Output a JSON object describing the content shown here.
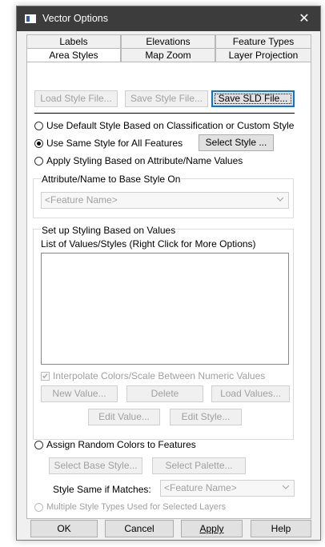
{
  "window": {
    "title": "Vector Options",
    "close_glyph": "✕"
  },
  "tabs": {
    "row1": [
      {
        "label": "Labels"
      },
      {
        "label": "Elevations"
      },
      {
        "label": "Feature Types"
      }
    ],
    "row2": [
      {
        "label": "Area Styles",
        "selected": true
      },
      {
        "label": "Map Zoom"
      },
      {
        "label": "Layer Projection"
      }
    ]
  },
  "style_file_buttons": {
    "load": "Load Style File...",
    "save": "Save Style File...",
    "save_sld": "Save SLD File..."
  },
  "style_mode": {
    "default": "Use Default Style Based on Classification or Custom Style",
    "same": "Use Same Style for All Features",
    "select_style": "Select Style ...",
    "attribute": "Apply Styling Based on Attribute/Name Values",
    "random": "Assign Random Colors to Features",
    "multiple": "Multiple Style Types Used for Selected Layers",
    "selected": "same"
  },
  "attribute_group": {
    "label": "Attribute/Name to Base Style On",
    "value": "<Feature Name>"
  },
  "values_group": {
    "label": "Set up Styling Based on Values",
    "list_label": "List of Values/Styles (Right Click for More Options)",
    "interpolate": "Interpolate Colors/Scale Between Numeric Values",
    "interpolate_checked": true,
    "new_value": "New Value...",
    "delete": "Delete",
    "load_values": "Load Values...",
    "edit_value": "Edit Value...",
    "edit_style": "Edit Style..."
  },
  "random_group": {
    "select_base_style": "Select Base Style...",
    "select_palette": "Select Palette...",
    "match_label": "Style Same if Matches:",
    "match_value": "<Feature Name>"
  },
  "footer": {
    "ok": "OK",
    "cancel": "Cancel",
    "apply": "Apply",
    "help": "Help"
  },
  "colors": {
    "titlebar": "#3c3c3c",
    "focus": "#0078d7",
    "disabled_text": "#a0a0a0"
  }
}
